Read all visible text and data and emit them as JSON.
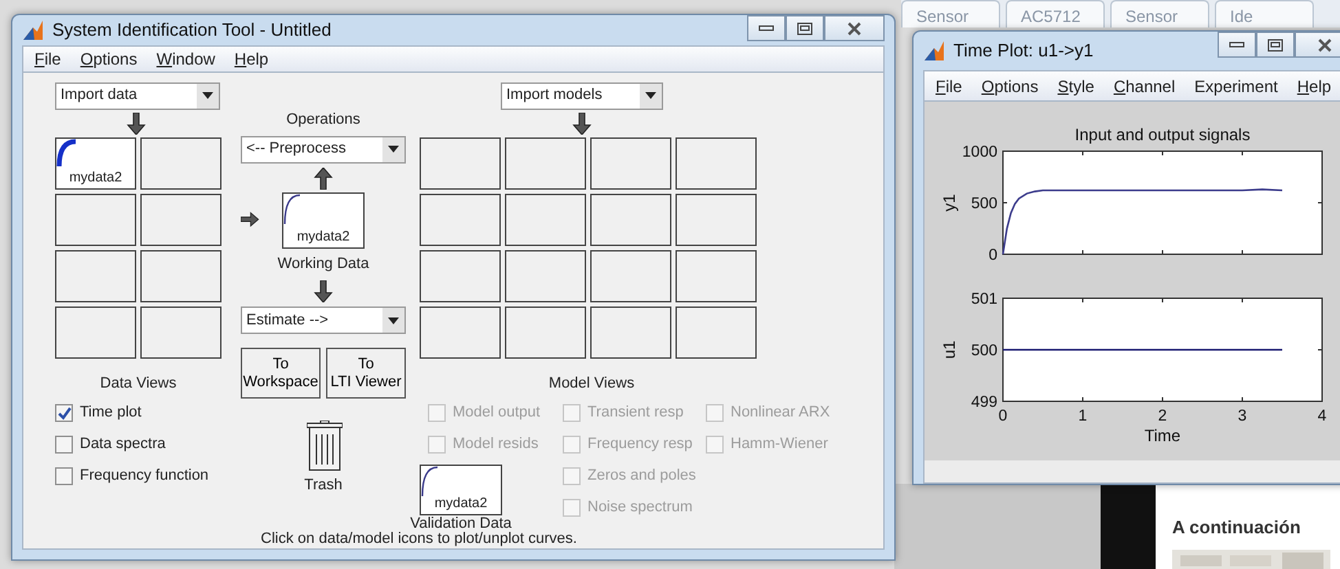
{
  "backdrop": {
    "tabs": [
      "Sensor",
      "AC5712",
      "Sensor",
      "Ide"
    ],
    "heading": "A continuación"
  },
  "main_window": {
    "title": "System Identification Tool - Untitled",
    "menu": [
      {
        "label": "File",
        "underline_first": true
      },
      {
        "label": "Options",
        "underline_first": true
      },
      {
        "label": "Window",
        "underline_first": true
      },
      {
        "label": "Help",
        "underline_first": true
      }
    ],
    "import_data": "Import data",
    "data_tiles": [
      {
        "kind": "data",
        "label": "mydata2",
        "plotted": true
      },
      {
        "kind": "empty"
      },
      {
        "kind": "empty"
      },
      {
        "kind": "empty"
      },
      {
        "kind": "empty"
      },
      {
        "kind": "empty"
      },
      {
        "kind": "empty"
      },
      {
        "kind": "empty"
      }
    ],
    "data_views": {
      "title": "Data Views",
      "options": [
        {
          "label": "Time plot",
          "checked": true,
          "disabled": false
        },
        {
          "label": "Data spectra",
          "checked": false,
          "disabled": false
        },
        {
          "label": "Frequency function",
          "checked": false,
          "disabled": false
        }
      ]
    },
    "operations": {
      "title": "Operations",
      "preprocess": "<-- Preprocess",
      "working_data": {
        "label": "mydata2",
        "plotted": false
      },
      "working_data_caption": "Working Data",
      "estimate": "Estimate -->",
      "buttons": [
        {
          "line1": "To",
          "line2": "Workspace"
        },
        {
          "line1": "To",
          "line2": "LTI Viewer"
        }
      ],
      "trash": "Trash"
    },
    "import_models": "Import models",
    "model_tiles": [
      {
        "kind": "empty"
      },
      {
        "kind": "empty"
      },
      {
        "kind": "empty"
      },
      {
        "kind": "empty"
      },
      {
        "kind": "empty"
      },
      {
        "kind": "empty"
      },
      {
        "kind": "empty"
      },
      {
        "kind": "empty"
      },
      {
        "kind": "empty"
      },
      {
        "kind": "empty"
      },
      {
        "kind": "empty"
      },
      {
        "kind": "empty"
      },
      {
        "kind": "empty"
      },
      {
        "kind": "empty"
      },
      {
        "kind": "empty"
      },
      {
        "kind": "empty"
      }
    ],
    "model_views": {
      "title": "Model Views",
      "columns": [
        [
          {
            "label": "Model output",
            "checked": false,
            "disabled": true
          },
          {
            "label": "Model resids",
            "checked": false,
            "disabled": true
          }
        ],
        [
          {
            "label": "Transient resp",
            "checked": false,
            "disabled": true
          },
          {
            "label": "Frequency resp",
            "checked": false,
            "disabled": true
          },
          {
            "label": "Zeros and poles",
            "checked": false,
            "disabled": true
          },
          {
            "label": "Noise spectrum",
            "checked": false,
            "disabled": true
          }
        ],
        [
          {
            "label": "Nonlinear ARX",
            "checked": false,
            "disabled": true
          },
          {
            "label": "Hamm-Wiener",
            "checked": false,
            "disabled": true
          }
        ]
      ]
    },
    "validation_data": {
      "label": "mydata2",
      "plotted": false
    },
    "validation_caption": "Validation Data",
    "hint": "Click on data/model icons to plot/unplot curves."
  },
  "plot_window": {
    "title": "Time Plot: u1->y1",
    "menu": [
      {
        "label": "File",
        "underline_first": true
      },
      {
        "label": "Options",
        "underline_first": true
      },
      {
        "label": "Style",
        "underline_first": true
      },
      {
        "label": "Channel",
        "underline_first": true
      },
      {
        "label": "Experiment",
        "underline_first": false
      },
      {
        "label": "Help",
        "underline_first": true
      }
    ],
    "charts": [
      {
        "chart_data": {
          "type": "line",
          "title": "Input and output signals",
          "ylabel": "y1",
          "xlim": [
            0,
            4
          ],
          "ylim": [
            0,
            1000
          ],
          "yticks": [
            0,
            500,
            1000
          ],
          "x": [
            0,
            0.05,
            0.1,
            0.15,
            0.2,
            0.3,
            0.4,
            0.5,
            0.75,
            1,
            1.5,
            2,
            2.5,
            3,
            3.25,
            3.5
          ],
          "series": [
            {
              "color": "#3c3c8c",
              "values": [
                0,
                250,
                400,
                490,
                540,
                590,
                610,
                620,
                620,
                620,
                620,
                620,
                620,
                620,
                630,
                620
              ]
            }
          ]
        }
      },
      {
        "chart_data": {
          "type": "line",
          "xlabel": "Time",
          "ylabel": "u1",
          "xlim": [
            0,
            4
          ],
          "ylim": [
            499,
            501
          ],
          "xticks": [
            0,
            1,
            2,
            3,
            4
          ],
          "yticks": [
            499,
            500,
            501
          ],
          "x": [
            0,
            3.5
          ],
          "series": [
            {
              "color": "#1a1a70",
              "values": [
                500,
                500
              ]
            }
          ]
        }
      }
    ]
  }
}
